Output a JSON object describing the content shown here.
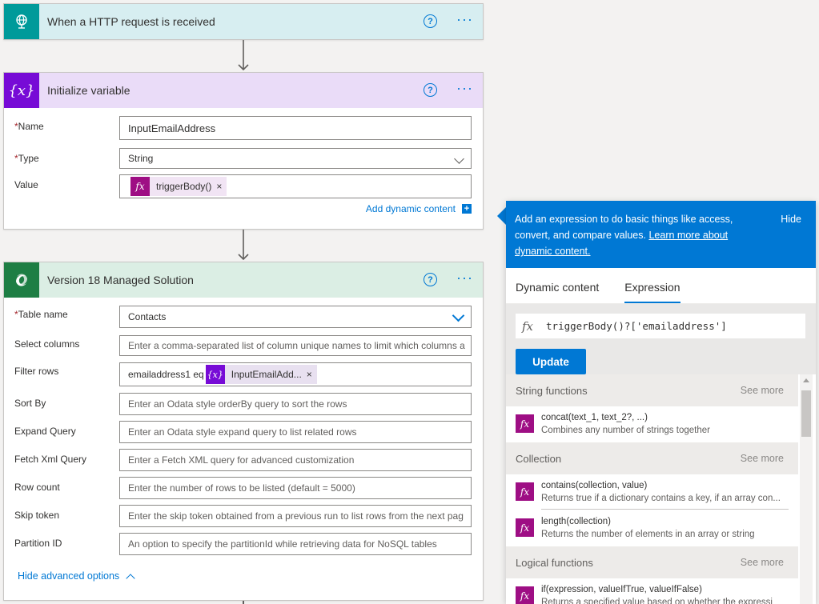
{
  "cards": {
    "http": {
      "title": "When a HTTP request is received"
    },
    "init": {
      "title": "Initialize variable",
      "icon_text": "{x}",
      "fields": {
        "name_label": "Name",
        "name_value": "InputEmailAddress",
        "type_label": "Type",
        "type_value": "String",
        "value_label": "Value",
        "value_token": "triggerBody()"
      },
      "add_dynamic": "Add dynamic content"
    },
    "dataverse": {
      "title": "Version 18 Managed Solution",
      "fields": {
        "table_label": "Table name",
        "table_value": "Contacts",
        "select_label": "Select columns",
        "select_placeholder": "Enter a comma-separated list of column unique names to limit which columns a",
        "filter_label": "Filter rows",
        "filter_text": "emailaddress1 eq",
        "filter_token": "InputEmailAdd...",
        "sort_label": "Sort By",
        "sort_placeholder": "Enter an Odata style orderBy query to sort the rows",
        "expand_label": "Expand Query",
        "expand_placeholder": "Enter an Odata style expand query to list related rows",
        "fetch_label": "Fetch Xml Query",
        "fetch_placeholder": "Enter a Fetch XML query for advanced customization",
        "rowcount_label": "Row count",
        "rowcount_placeholder": "Enter the number of rows to be listed (default = 5000)",
        "skip_label": "Skip token",
        "skip_placeholder": "Enter the skip token obtained from a previous run to list rows from the next pag",
        "partition_label": "Partition ID",
        "partition_placeholder": "An option to specify the partitionId while retrieving data for NoSQL tables"
      },
      "hide_advanced": "Hide advanced options"
    }
  },
  "panel": {
    "description": "Add an expression to do basic things like access, convert, and compare values.",
    "learn_more": "Learn more about dynamic content.",
    "hide": "Hide",
    "tabs": [
      "Dynamic content",
      "Expression"
    ],
    "expression_value": "triggerBody()?['emailaddress']",
    "update_label": "Update",
    "sections": [
      {
        "name": "String functions",
        "see_more": "See more",
        "items": [
          {
            "name": "concat(text_1, text_2?, ...)",
            "desc": "Combines any number of strings together"
          }
        ]
      },
      {
        "name": "Collection",
        "see_more": "See more",
        "items": [
          {
            "name": "contains(collection, value)",
            "desc": "Returns true if a dictionary contains a key, if an array con..."
          },
          {
            "name": "length(collection)",
            "desc": "Returns the number of elements in an array or string"
          }
        ]
      },
      {
        "name": "Logical functions",
        "see_more": "See more",
        "items": [
          {
            "name": "if(expression, valueIfTrue, valueIfFalse)",
            "desc": "Returns a specified value based on whether the expressi"
          }
        ]
      }
    ]
  },
  "colors": {
    "http_header": "#d7eef1",
    "http_icon": "#009a9a",
    "init_header": "#eadcf8",
    "init_icon": "#770bd6",
    "dv_header": "#dbeee4",
    "dv_icon": "#1e7e44",
    "accent": "#0078d4",
    "fx": "#9e0e84"
  }
}
